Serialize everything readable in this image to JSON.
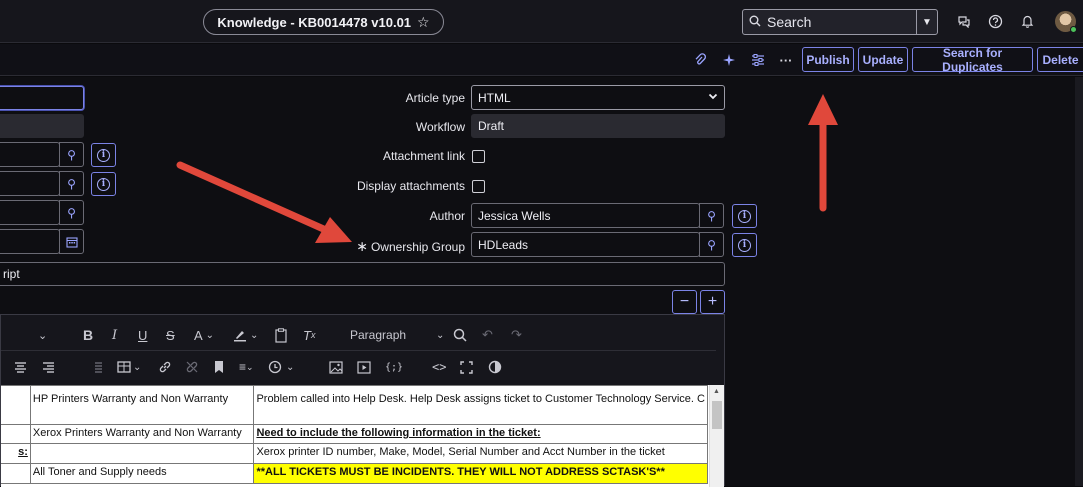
{
  "header": {
    "record_title": "Knowledge - KB0014478 v10.01",
    "star_icon": "☆",
    "search_label": "Search"
  },
  "actions": {
    "publish": "Publish",
    "update": "Update",
    "search_duplicates": "Search for Duplicates",
    "delete": "Delete"
  },
  "form": {
    "article_type": {
      "label": "Article type",
      "value": "HTML"
    },
    "workflow": {
      "label": "Workflow",
      "value": "Draft"
    },
    "attachment_link": {
      "label": "Attachment link",
      "checked": false
    },
    "display_attachments": {
      "label": "Display attachments",
      "checked": false
    },
    "author": {
      "label": "Author",
      "value": "Jessica Wells"
    },
    "ownership_group": {
      "label": "Ownership Group",
      "value": "HDLeads",
      "required_mark": "∗"
    },
    "short_description_partial": "ript"
  },
  "editor": {
    "paragraph_format": "Paragraph",
    "table_rows": [
      [
        "",
        "HP Printers Warranty and Non Warranty",
        "Problem called into Help Desk.  Help Desk assigns ticket to Customer Technology Service.  C"
      ],
      [
        "",
        "Xerox Printers Warranty and Non Warranty",
        "Need to include the following information in the ticket:"
      ],
      [
        "s:",
        "",
        "Xerox printer ID number, Make, Model, Serial Number and Acct Number in the ticket"
      ],
      [
        "",
        "All Toner and Supply needs",
        "**ALL TICKETS MUST BE INCIDENTS. THEY WILL NOT ADDRESS SCTASK'S**"
      ]
    ]
  },
  "colors": {
    "accent": "#7b83e6",
    "annotation_arrow": "#e0483b",
    "highlight": "#ffff00"
  }
}
